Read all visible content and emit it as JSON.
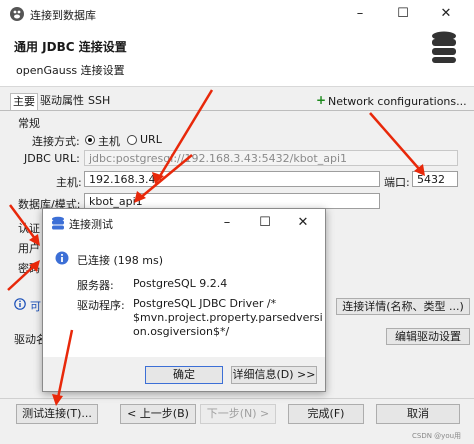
{
  "window": {
    "title": "连接到数据库",
    "minimize": "–",
    "maximize": "☐",
    "close": "✕"
  },
  "header": {
    "title": "通用 JDBC 连接设置",
    "subtitle": "openGauss 连接设置"
  },
  "tabs": [
    {
      "label": "主要"
    },
    {
      "label": "驱动属性"
    },
    {
      "label": "SSH"
    }
  ],
  "network_config": {
    "label": "Network configurations..."
  },
  "form": {
    "section_general": "常规",
    "connect_method_label": "连接方式:",
    "option_host": "主机",
    "option_url": "URL",
    "jdbc_url_label": "JDBC URL:",
    "jdbc_url_value": "jdbc:postgresql://192.168.3.43:5432/kbot_api1",
    "host_label": "主机:",
    "host_value": "192.168.3.43",
    "port_label": "端口:",
    "port_value": "5432",
    "db_label": "数据库/模式:",
    "db_value": "kbot_api1",
    "auth_label": "认证",
    "user_label": "用户",
    "password_label": "密码",
    "driver_label": "驱动名",
    "info_text": "可",
    "conn_details_button": "连接详情(名称、类型 ...)",
    "edit_driver_button": "编辑驱动设置"
  },
  "footer": {
    "test_button": "测试连接(T)...",
    "back_button": "< 上一步(B)",
    "next_button": "下一步(N) >",
    "finish_button": "完成(F)",
    "cancel_button": "取消",
    "watermark": "CSDN @you用"
  },
  "dialog": {
    "title": "连接测试",
    "status": "已连接 (198 ms)",
    "server_label": "服务器:",
    "server_value": "PostgreSQL 9.2.4",
    "driver_label": "驱动程序:",
    "driver_value": "PostgreSQL JDBC Driver /*\n$mvn.project.property.parsedversi\non.osgiversion$*/",
    "ok_button": "确定",
    "details_button": "详细信息(D) >>"
  },
  "colors": {
    "annotation": "#e8280a",
    "status_icon": "#3c6fd6",
    "accent_link": "#1a4fb8"
  },
  "icons": {
    "app": "database-app-icon",
    "header": "database-stack-icon",
    "status": "info-icon",
    "plus": "plus-icon"
  }
}
